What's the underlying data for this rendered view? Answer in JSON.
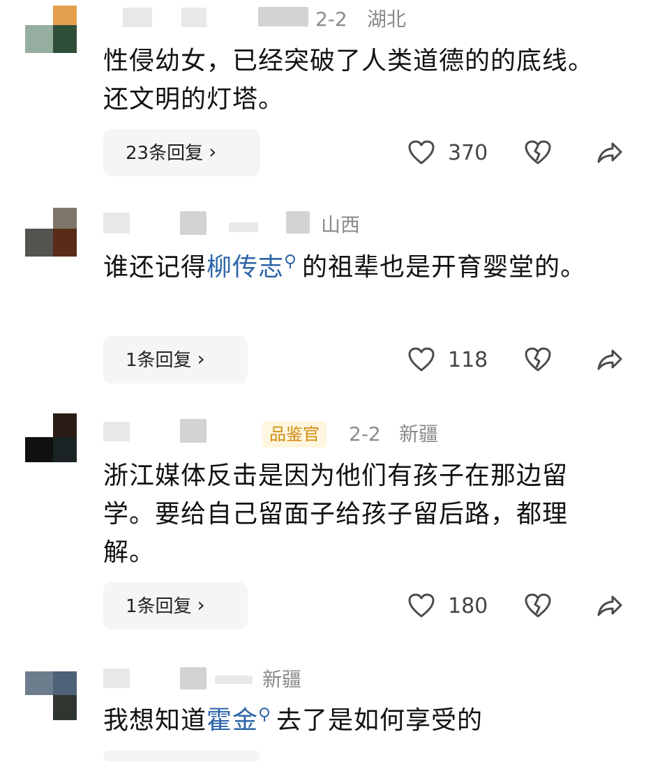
{
  "comments": [
    {
      "meta": {
        "date": "2-2",
        "location": "湖北"
      },
      "text": "性侵幼女，已经突破了人类道德的的底线。还文明的灯塔。",
      "reply_label": "23条回复",
      "likes": "370",
      "avatar_colors": [
        "#e5a04e",
        "#96aea0",
        "#304f3a"
      ]
    },
    {
      "meta": {
        "location": "山西"
      },
      "text_before": "谁还记得",
      "mention": "柳传志",
      "text_after": "的祖辈也是开育婴堂的。",
      "reply_label": "1条回复",
      "likes": "118",
      "avatar_colors": [
        "#7c7768",
        "#545451",
        "#5a2b18"
      ]
    },
    {
      "meta": {
        "badge": "品鉴官",
        "date": "2-2",
        "location": "新疆"
      },
      "text": "浙江媒体反击是因为他们有孩子在那边留学。要给自己留面子给孩子留后路，都理解。",
      "reply_label": "1条回复",
      "likes": "180",
      "avatar_colors": [
        "#2a1b14",
        "#101010",
        "#1b2324"
      ]
    },
    {
      "meta": {
        "location": "新疆"
      },
      "text_before": "我想知道",
      "mention": "霍金",
      "text_after": "去了是如何享受的",
      "avatar_colors": [
        "#6e7d8e",
        "#4e6277",
        "#2f3630"
      ]
    }
  ],
  "colors": {
    "meta_text": "#8a8a8a",
    "mention": "#2b64a8",
    "badge_text": "#d38a10",
    "badge_background": "#fff6df",
    "reply_background": "#f5f5f5"
  },
  "icons": {
    "like": "heart-outline-icon",
    "dislike": "broken-heart-icon",
    "share": "share-arrow-icon",
    "mention": "search-icon",
    "reply": "chevron-right-icon"
  }
}
